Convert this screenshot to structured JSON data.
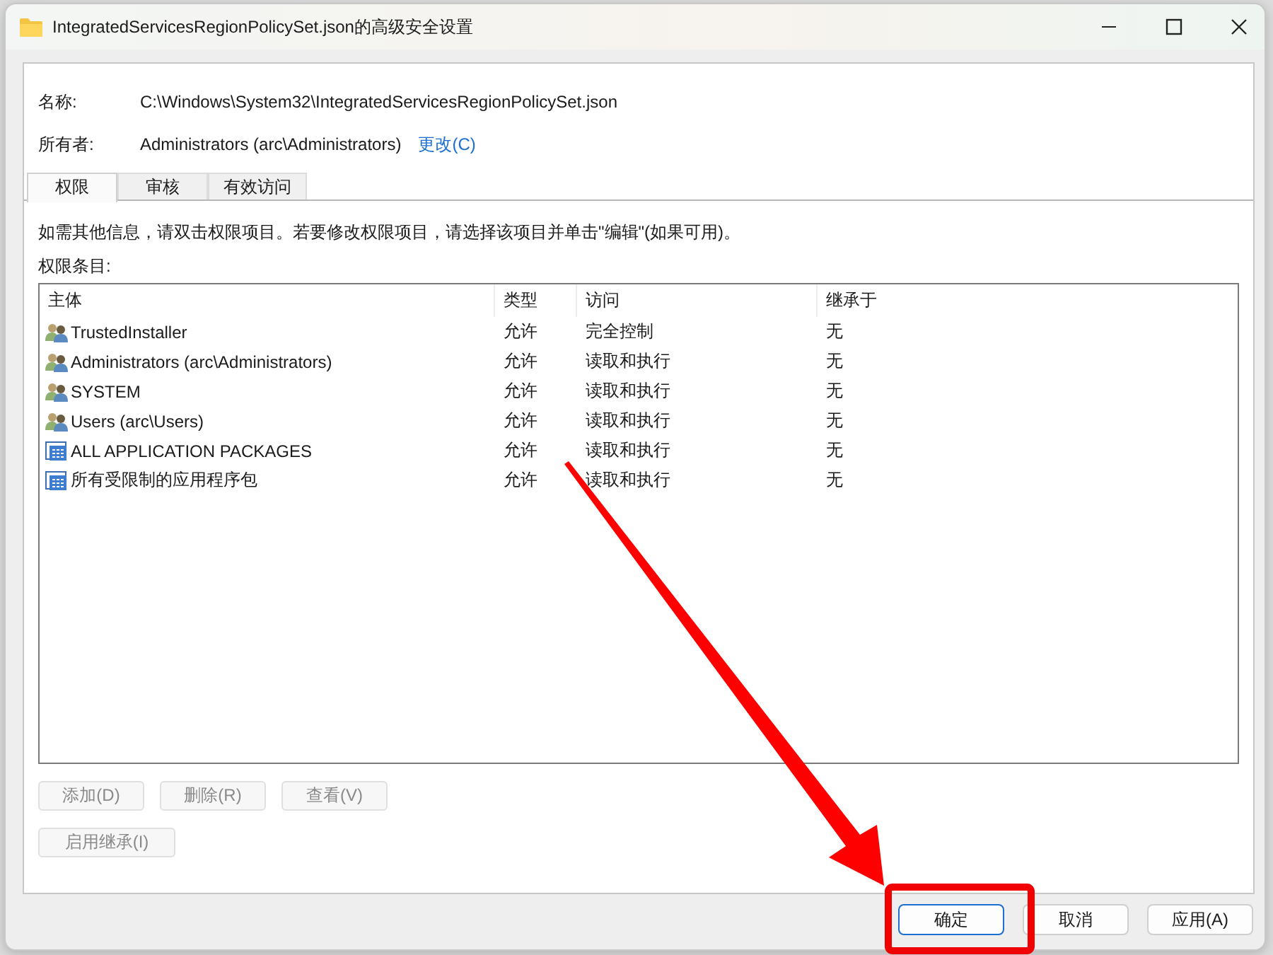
{
  "window": {
    "title": "IntegratedServicesRegionPolicySet.json的高级安全设置"
  },
  "name": {
    "label": "名称:",
    "value": "C:\\Windows\\System32\\IntegratedServicesRegionPolicySet.json"
  },
  "owner": {
    "label": "所有者:",
    "value": "Administrators (arc\\Administrators)",
    "link": "更改(C)"
  },
  "tabs": [
    {
      "label": "权限",
      "selected": true
    },
    {
      "label": "审核",
      "selected": false
    },
    {
      "label": "有效访问",
      "selected": false
    }
  ],
  "info": "如需其他信息，请双击权限项目。若要修改权限项目，请选择该项目并单击\"编辑\"(如果可用)。",
  "entries_label": "权限条目:",
  "table": {
    "columns": [
      "主体",
      "类型",
      "访问",
      "继承于"
    ],
    "rows": [
      {
        "kind": "group",
        "principal": "TrustedInstaller",
        "type": "允许",
        "access": "完全控制",
        "inherited": "无"
      },
      {
        "kind": "group",
        "principal": "Administrators (arc\\Administrators)",
        "type": "允许",
        "access": "读取和执行",
        "inherited": "无"
      },
      {
        "kind": "group",
        "principal": "SYSTEM",
        "type": "允许",
        "access": "读取和执行",
        "inherited": "无"
      },
      {
        "kind": "group",
        "principal": "Users (arc\\Users)",
        "type": "允许",
        "access": "读取和执行",
        "inherited": "无"
      },
      {
        "kind": "package",
        "principal": "ALL APPLICATION PACKAGES",
        "type": "允许",
        "access": "读取和执行",
        "inherited": "无"
      },
      {
        "kind": "package",
        "principal": "所有受限制的应用程序包",
        "type": "允许",
        "access": "读取和执行",
        "inherited": "无"
      }
    ]
  },
  "entry_buttons": [
    {
      "label": "添加(D)",
      "disabled": true
    },
    {
      "label": "删除(R)",
      "disabled": true
    },
    {
      "label": "查看(V)",
      "disabled": true
    }
  ],
  "inherit_button": {
    "label": "启用继承(I)",
    "disabled": true
  },
  "dialog_buttons": [
    {
      "label": "确定",
      "default": true
    },
    {
      "label": "取消",
      "default": false
    },
    {
      "label": "应用(A)",
      "default": false
    }
  ]
}
